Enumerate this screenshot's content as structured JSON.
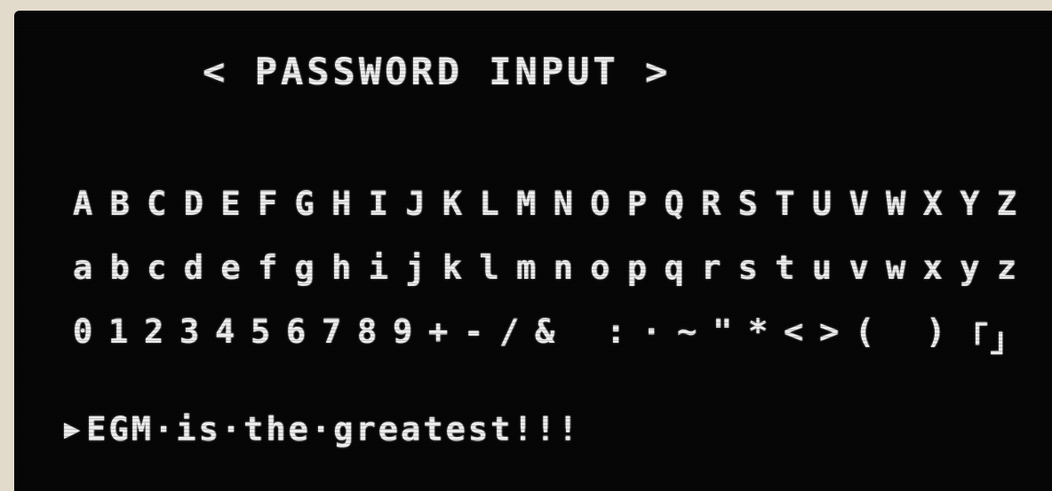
{
  "screen": {
    "title": "< PASSWORD INPUT >",
    "uppercase_row": "ABCDEFGHIJKLMNOPQRSTUVWXYZ",
    "lowercase_row": "abcdefghijklmnopqrstuvwxyz",
    "symbols_row": "0123456789+-/& :·~\"*<>( )「」",
    "entry_cursor": "▶",
    "entry_text": "EGM·is·the·greatest!!!"
  }
}
